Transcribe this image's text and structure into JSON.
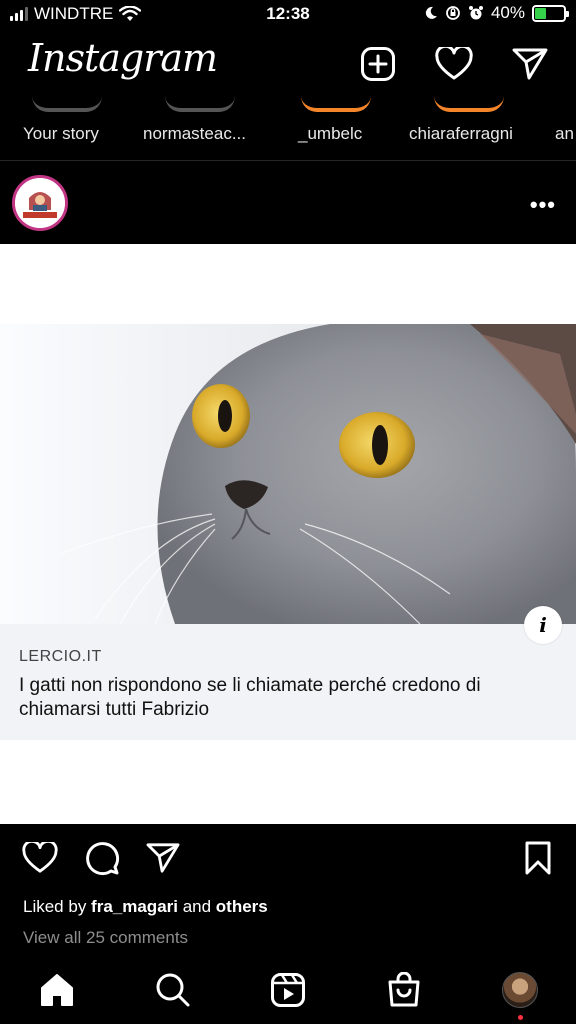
{
  "status_bar": {
    "carrier": "WINDTRE",
    "time": "12:38",
    "battery": "40%",
    "battery_level": 0.4
  },
  "header": {
    "logo": "Instagram",
    "icons": [
      "new-post-icon",
      "heart-icon",
      "direct-message-icon"
    ]
  },
  "stories": [
    {
      "label": "Your story",
      "ring": "#555555"
    },
    {
      "label": "normasteac...",
      "ring": "#555555"
    },
    {
      "label": "_umbelc",
      "ring": "#f58529"
    },
    {
      "label": "chiaraferragni",
      "ring": "#f58529"
    },
    {
      "label": "an",
      "ring": "#f58529"
    }
  ],
  "post": {
    "more_label": "•••",
    "link": {
      "domain": "LERCIO.IT",
      "title": "I gatti non rispondono se li chiamate perché credono di chiamarsi tutti Fabrizio"
    },
    "info_label": "i",
    "likes": {
      "prefix": "Liked by ",
      "user": "fra_magari",
      "middle": " and ",
      "suffix": "others"
    },
    "comments": "View all 25 comments"
  },
  "tabbar": {
    "items": [
      "home-icon",
      "search-icon",
      "reels-icon",
      "shop-icon",
      "profile-avatar"
    ]
  },
  "colors": {
    "background": "#000000",
    "post_background": "#ffffff",
    "link_card": "#f2f3f6",
    "battery_fill": "#36d14b",
    "notification": "#ff3040"
  }
}
